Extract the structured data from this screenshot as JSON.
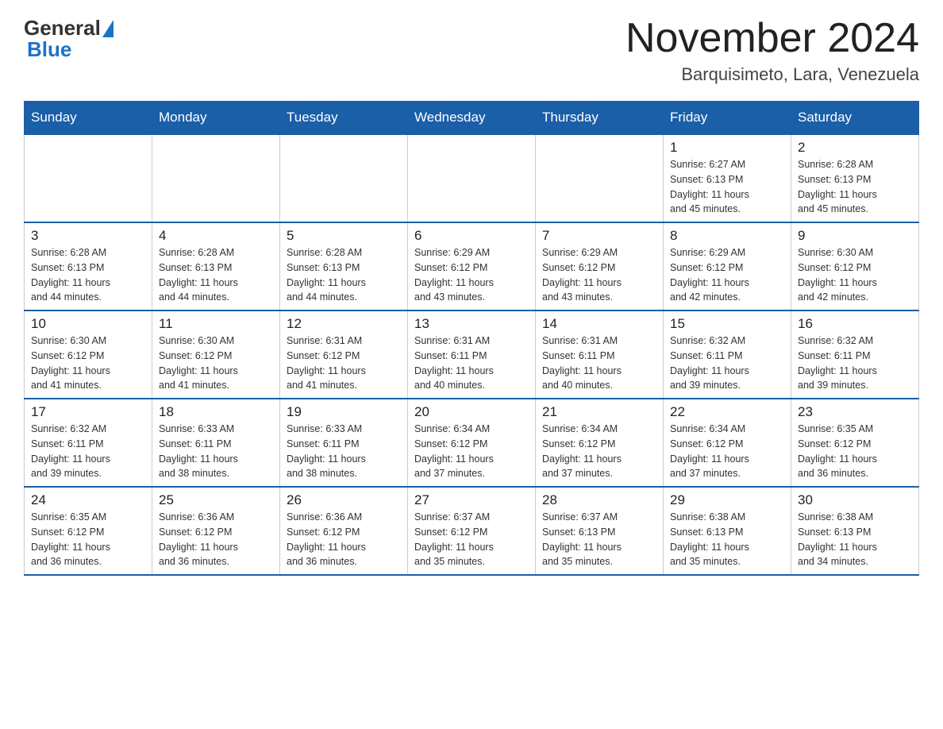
{
  "logo": {
    "general": "General",
    "blue": "Blue"
  },
  "title": "November 2024",
  "location": "Barquisimeto, Lara, Venezuela",
  "days_of_week": [
    "Sunday",
    "Monday",
    "Tuesday",
    "Wednesday",
    "Thursday",
    "Friday",
    "Saturday"
  ],
  "weeks": [
    [
      {
        "day": "",
        "info": ""
      },
      {
        "day": "",
        "info": ""
      },
      {
        "day": "",
        "info": ""
      },
      {
        "day": "",
        "info": ""
      },
      {
        "day": "",
        "info": ""
      },
      {
        "day": "1",
        "info": "Sunrise: 6:27 AM\nSunset: 6:13 PM\nDaylight: 11 hours\nand 45 minutes."
      },
      {
        "day": "2",
        "info": "Sunrise: 6:28 AM\nSunset: 6:13 PM\nDaylight: 11 hours\nand 45 minutes."
      }
    ],
    [
      {
        "day": "3",
        "info": "Sunrise: 6:28 AM\nSunset: 6:13 PM\nDaylight: 11 hours\nand 44 minutes."
      },
      {
        "day": "4",
        "info": "Sunrise: 6:28 AM\nSunset: 6:13 PM\nDaylight: 11 hours\nand 44 minutes."
      },
      {
        "day": "5",
        "info": "Sunrise: 6:28 AM\nSunset: 6:13 PM\nDaylight: 11 hours\nand 44 minutes."
      },
      {
        "day": "6",
        "info": "Sunrise: 6:29 AM\nSunset: 6:12 PM\nDaylight: 11 hours\nand 43 minutes."
      },
      {
        "day": "7",
        "info": "Sunrise: 6:29 AM\nSunset: 6:12 PM\nDaylight: 11 hours\nand 43 minutes."
      },
      {
        "day": "8",
        "info": "Sunrise: 6:29 AM\nSunset: 6:12 PM\nDaylight: 11 hours\nand 42 minutes."
      },
      {
        "day": "9",
        "info": "Sunrise: 6:30 AM\nSunset: 6:12 PM\nDaylight: 11 hours\nand 42 minutes."
      }
    ],
    [
      {
        "day": "10",
        "info": "Sunrise: 6:30 AM\nSunset: 6:12 PM\nDaylight: 11 hours\nand 41 minutes."
      },
      {
        "day": "11",
        "info": "Sunrise: 6:30 AM\nSunset: 6:12 PM\nDaylight: 11 hours\nand 41 minutes."
      },
      {
        "day": "12",
        "info": "Sunrise: 6:31 AM\nSunset: 6:12 PM\nDaylight: 11 hours\nand 41 minutes."
      },
      {
        "day": "13",
        "info": "Sunrise: 6:31 AM\nSunset: 6:11 PM\nDaylight: 11 hours\nand 40 minutes."
      },
      {
        "day": "14",
        "info": "Sunrise: 6:31 AM\nSunset: 6:11 PM\nDaylight: 11 hours\nand 40 minutes."
      },
      {
        "day": "15",
        "info": "Sunrise: 6:32 AM\nSunset: 6:11 PM\nDaylight: 11 hours\nand 39 minutes."
      },
      {
        "day": "16",
        "info": "Sunrise: 6:32 AM\nSunset: 6:11 PM\nDaylight: 11 hours\nand 39 minutes."
      }
    ],
    [
      {
        "day": "17",
        "info": "Sunrise: 6:32 AM\nSunset: 6:11 PM\nDaylight: 11 hours\nand 39 minutes."
      },
      {
        "day": "18",
        "info": "Sunrise: 6:33 AM\nSunset: 6:11 PM\nDaylight: 11 hours\nand 38 minutes."
      },
      {
        "day": "19",
        "info": "Sunrise: 6:33 AM\nSunset: 6:11 PM\nDaylight: 11 hours\nand 38 minutes."
      },
      {
        "day": "20",
        "info": "Sunrise: 6:34 AM\nSunset: 6:12 PM\nDaylight: 11 hours\nand 37 minutes."
      },
      {
        "day": "21",
        "info": "Sunrise: 6:34 AM\nSunset: 6:12 PM\nDaylight: 11 hours\nand 37 minutes."
      },
      {
        "day": "22",
        "info": "Sunrise: 6:34 AM\nSunset: 6:12 PM\nDaylight: 11 hours\nand 37 minutes."
      },
      {
        "day": "23",
        "info": "Sunrise: 6:35 AM\nSunset: 6:12 PM\nDaylight: 11 hours\nand 36 minutes."
      }
    ],
    [
      {
        "day": "24",
        "info": "Sunrise: 6:35 AM\nSunset: 6:12 PM\nDaylight: 11 hours\nand 36 minutes."
      },
      {
        "day": "25",
        "info": "Sunrise: 6:36 AM\nSunset: 6:12 PM\nDaylight: 11 hours\nand 36 minutes."
      },
      {
        "day": "26",
        "info": "Sunrise: 6:36 AM\nSunset: 6:12 PM\nDaylight: 11 hours\nand 36 minutes."
      },
      {
        "day": "27",
        "info": "Sunrise: 6:37 AM\nSunset: 6:12 PM\nDaylight: 11 hours\nand 35 minutes."
      },
      {
        "day": "28",
        "info": "Sunrise: 6:37 AM\nSunset: 6:13 PM\nDaylight: 11 hours\nand 35 minutes."
      },
      {
        "day": "29",
        "info": "Sunrise: 6:38 AM\nSunset: 6:13 PM\nDaylight: 11 hours\nand 35 minutes."
      },
      {
        "day": "30",
        "info": "Sunrise: 6:38 AM\nSunset: 6:13 PM\nDaylight: 11 hours\nand 34 minutes."
      }
    ]
  ]
}
